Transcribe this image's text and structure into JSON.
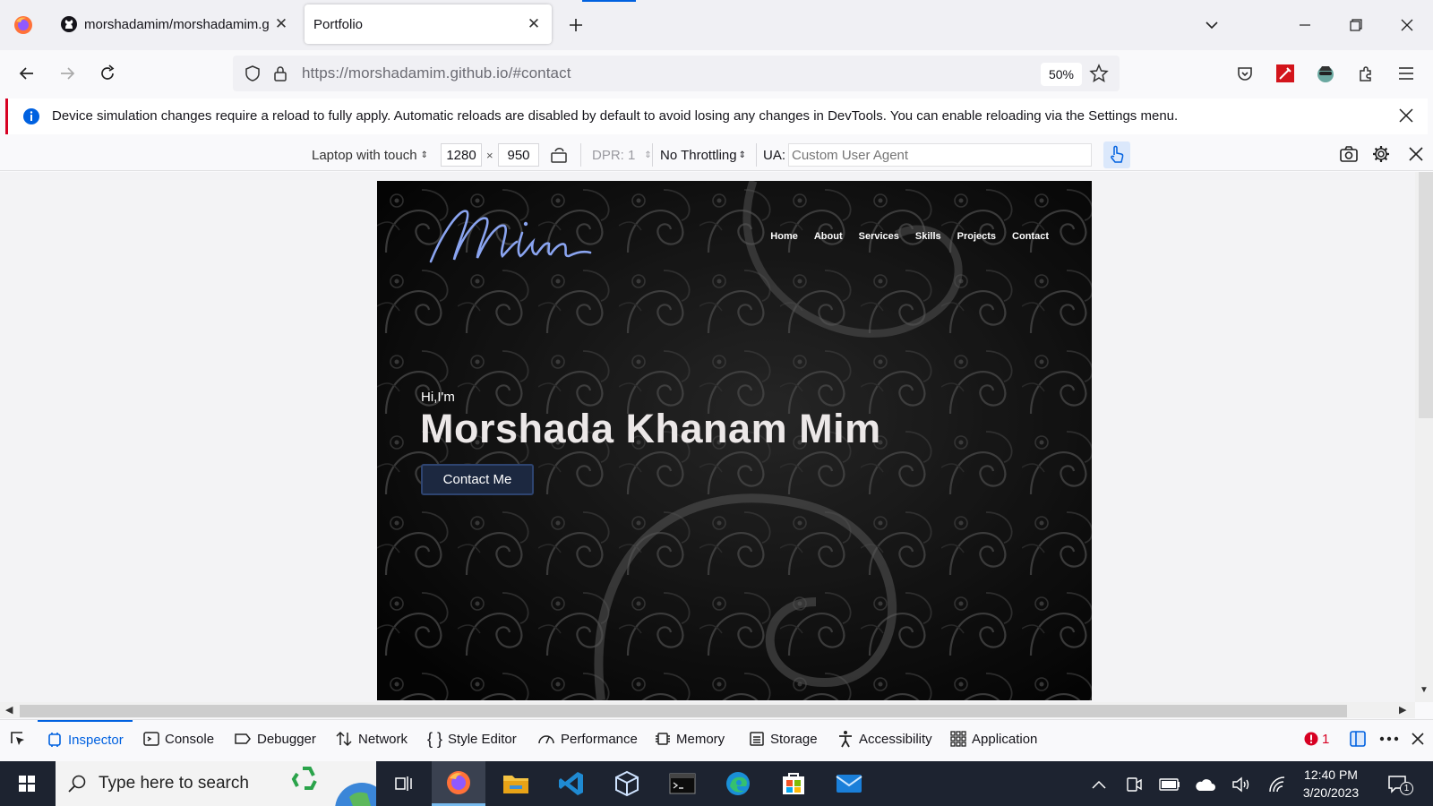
{
  "browser": {
    "tabs": [
      {
        "title": "morshadamim/morshadamim.g",
        "active": false
      },
      {
        "title": "Portfolio",
        "active": true
      }
    ],
    "url_host": "https://morshadamim.github.io",
    "url_path": "/#contact",
    "zoom": "50%"
  },
  "notification": {
    "text": "Device simulation changes require a reload to fully apply. Automatic reloads are disabled by default to avoid losing any changes in DevTools. You can enable reloading via the Settings menu."
  },
  "rdm": {
    "device": "Laptop with touch",
    "width": "1280",
    "times": "×",
    "height": "950",
    "dpr": "DPR: 1",
    "throttling": "No Throttling",
    "ua_label": "UA:",
    "ua_placeholder": "Custom User Agent"
  },
  "site": {
    "logo_text": "Mim",
    "nav": [
      "Home",
      "About",
      "Services",
      "Skills",
      "Projects",
      "Contact"
    ],
    "greeting": "Hi,I'm",
    "name": "Morshada Khanam Mim",
    "cta": "Contact Me",
    "colors": {
      "logo": "#8aa4f0",
      "cta_bg": "#1c2840"
    }
  },
  "devtools": {
    "tabs": [
      "Inspector",
      "Console",
      "Debugger",
      "Network",
      "Style Editor",
      "Performance",
      "Memory",
      "Storage",
      "Accessibility",
      "Application"
    ],
    "error_count": "1"
  },
  "taskbar": {
    "search_placeholder": "Type here to search",
    "time": "12:40 PM",
    "date": "3/20/2023",
    "notification_count": "1"
  }
}
